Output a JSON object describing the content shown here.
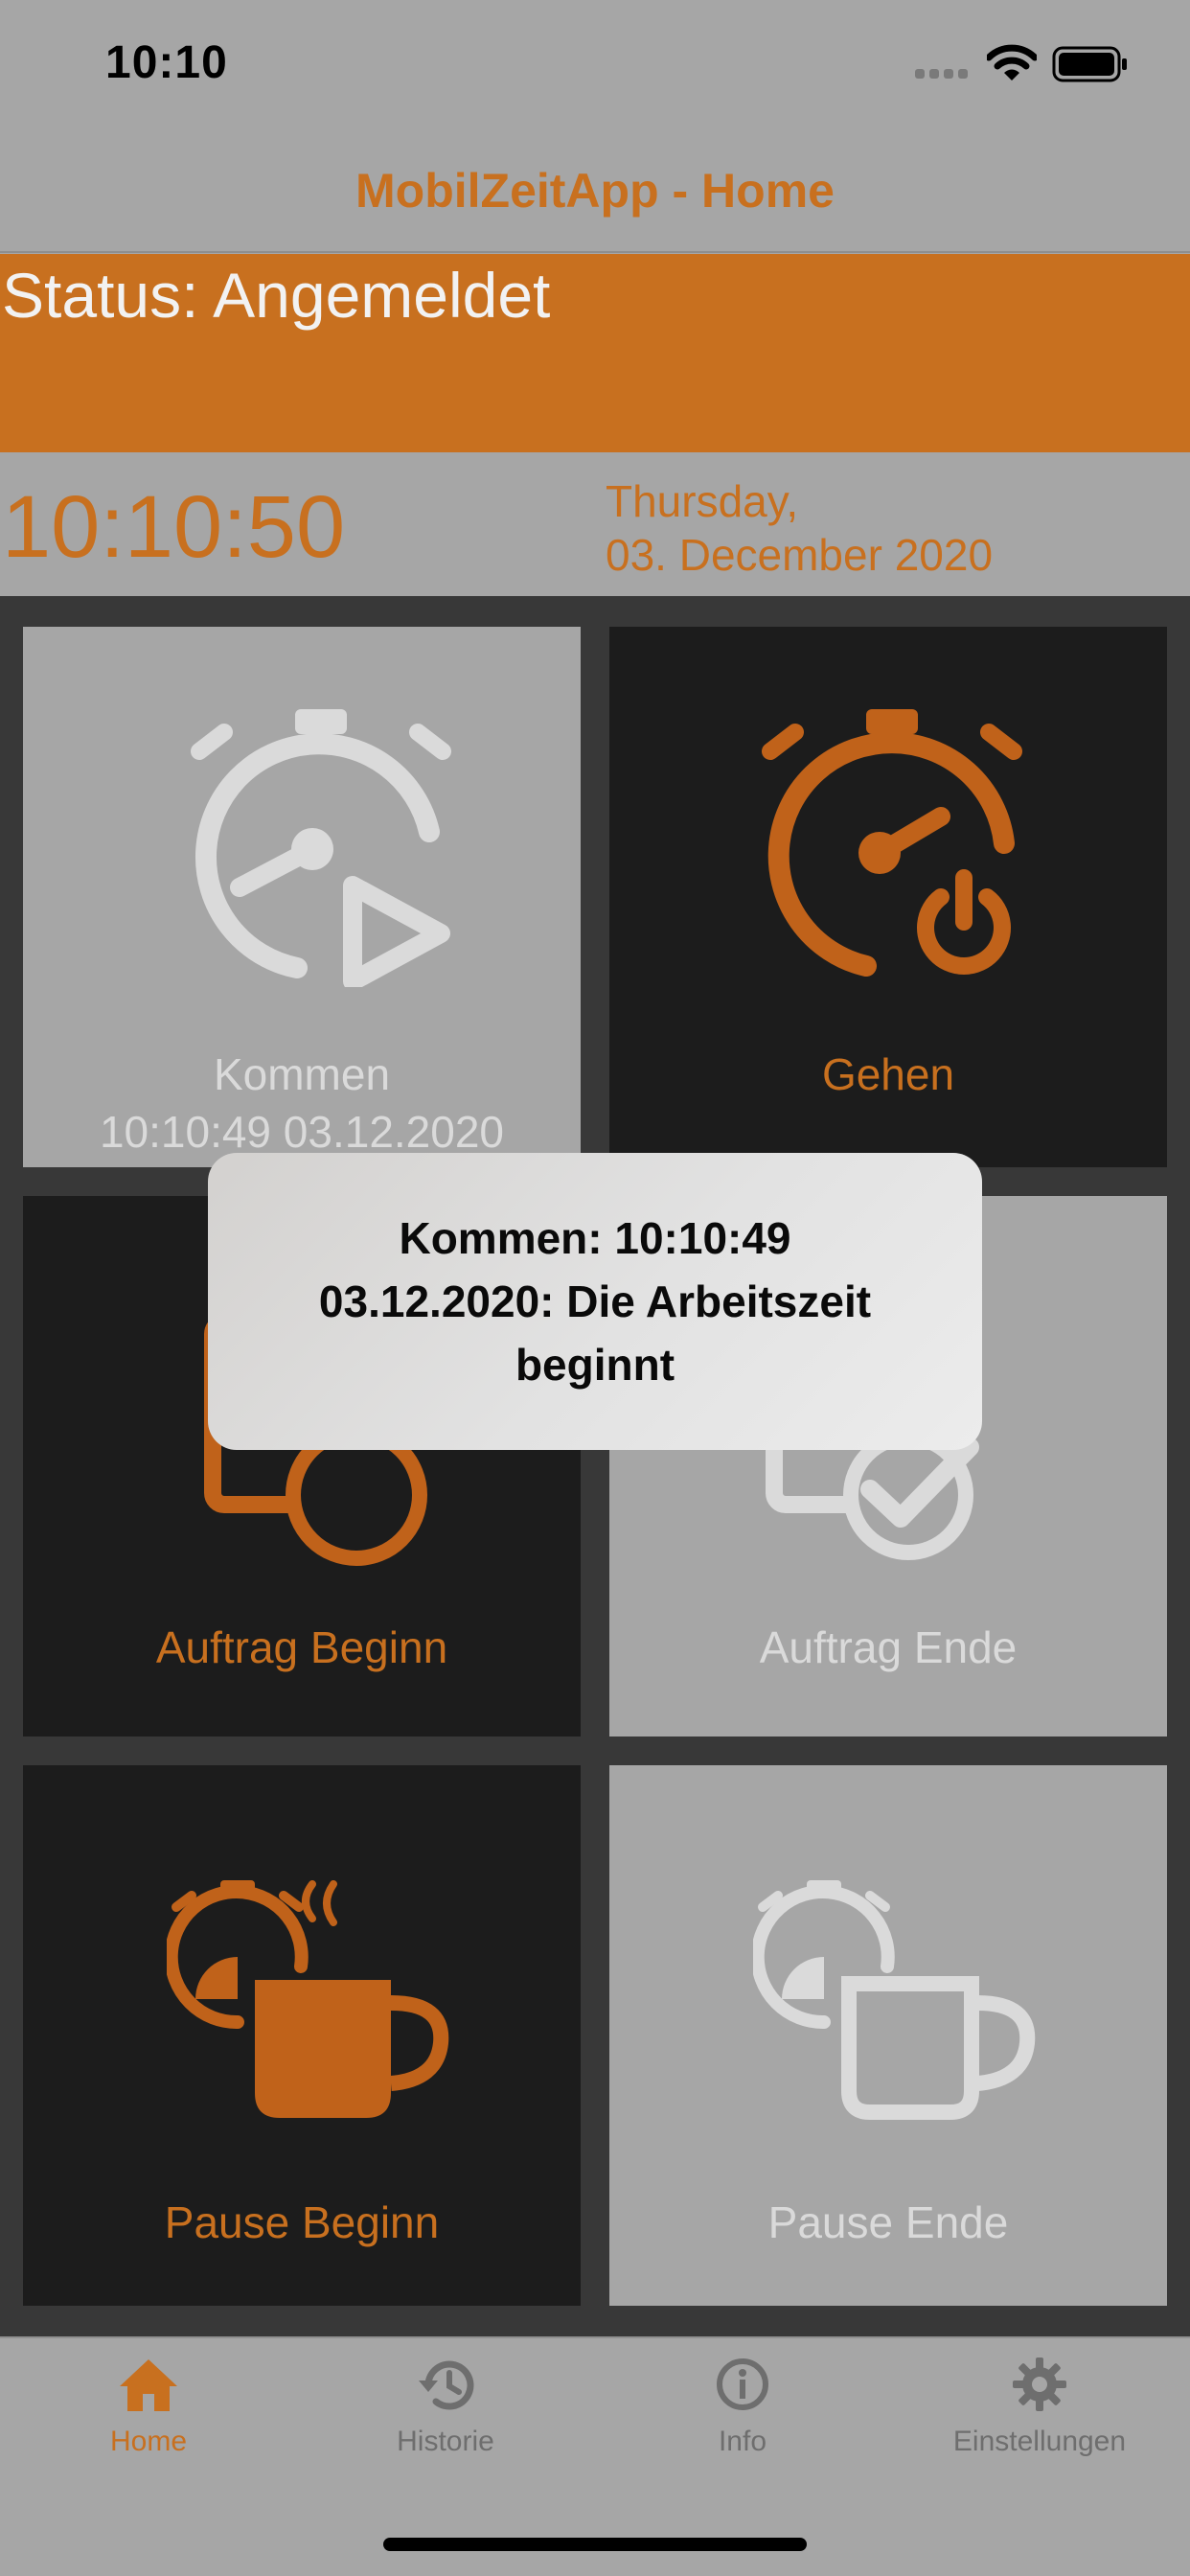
{
  "status_bar": {
    "time": "10:10"
  },
  "nav": {
    "title": "MobilZeitApp - Home"
  },
  "status": {
    "text": "Status: Angemeldet"
  },
  "clock": {
    "time": "10:10:50",
    "date_line1": "Thursday,",
    "date_line2": "03. December 2020"
  },
  "tiles": [
    {
      "label": "Kommen",
      "sublabel": "10:10:49 03.12.2020",
      "icon": "stopwatch-play-icon"
    },
    {
      "label": "Gehen",
      "icon": "stopwatch-power-icon"
    },
    {
      "label": "Auftrag Beginn",
      "icon": "clipboard-timer-icon"
    },
    {
      "label": "Auftrag Ende",
      "icon": "clipboard-check-icon"
    },
    {
      "label": "Pause Beginn",
      "icon": "coffee-timer-icon"
    },
    {
      "label": "Pause Ende",
      "icon": "coffee-timer-outline-icon"
    }
  ],
  "toast": {
    "line1": "Kommen: 10:10:49",
    "line2": "03.12.2020: Die Arbeitszeit",
    "line3": "beginnt"
  },
  "tabs": [
    {
      "label": "Home",
      "icon": "home-icon",
      "active": true
    },
    {
      "label": "Historie",
      "icon": "history-icon"
    },
    {
      "label": "Info",
      "icon": "info-icon"
    },
    {
      "label": "Einstellungen",
      "icon": "gear-icon"
    }
  ],
  "colors": {
    "accent": "#c8701f",
    "background": "#a6a6a6",
    "dark_tile": "#1c1c1c"
  }
}
